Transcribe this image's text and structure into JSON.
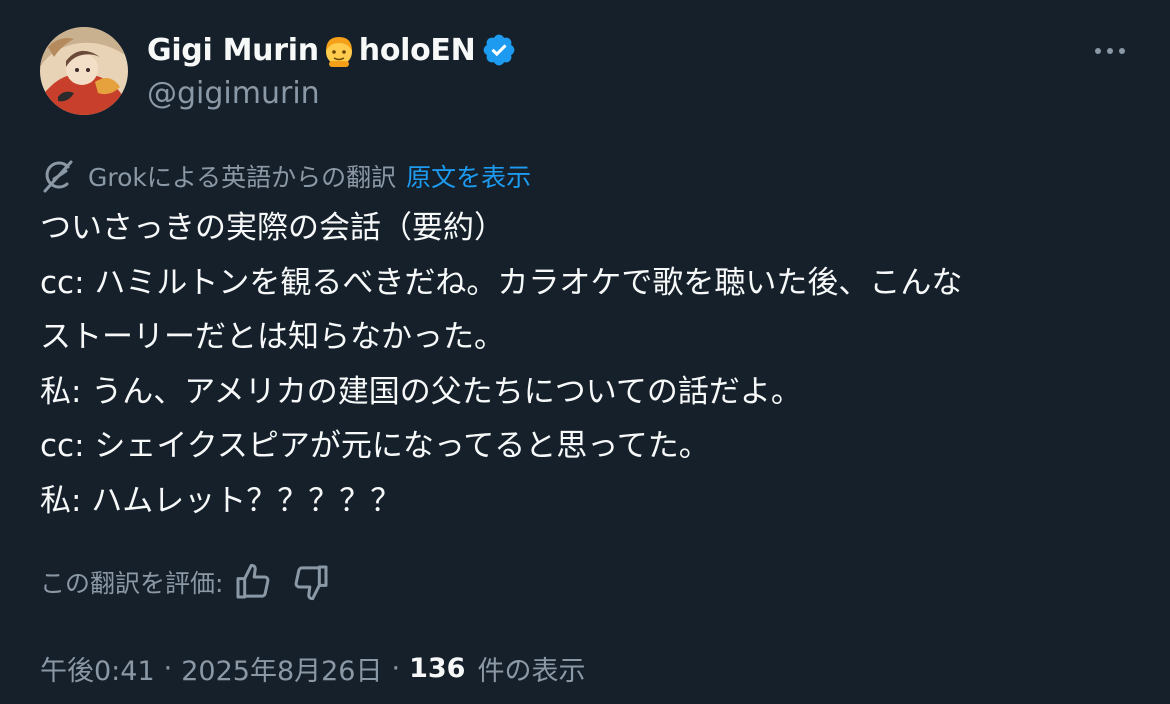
{
  "author": {
    "display_name_part1": "Gigi Murin",
    "display_name_part2": "holoEN",
    "emoji": "cartoon-girl-emoji",
    "handle": "@gigimurin",
    "verified": true,
    "verified_color": "#1d9bf0"
  },
  "translation": {
    "label": "Grokによる英語からの翻訳",
    "show_original": "原文を表示",
    "icon": "grok-icon"
  },
  "tweet": {
    "lines": [
      "ついさっきの実際の会話（要約）",
      "cc: ハミルトンを観るべきだね。カラオケで歌を聴いた後、こんな",
      "ストーリーだとは知らなかった。",
      "私: うん、アメリカの建国の父たちについての話だよ。",
      "cc: シェイクスピアが元になってると思ってた。",
      "私: ハムレット？？？？？"
    ]
  },
  "rating": {
    "label": "この翻訳を評価:",
    "like_icon": "thumbs-up-icon",
    "dislike_icon": "thumbs-down-icon"
  },
  "meta": {
    "time": "午後0:41",
    "separator": "·",
    "date": "2025年8月26日",
    "views_count": "136",
    "views_label": "件の表示"
  },
  "colors": {
    "background": "#15202b",
    "text_primary": "#f7f9f9",
    "text_secondary": "#8b98a5",
    "accent": "#1d9bf0"
  }
}
